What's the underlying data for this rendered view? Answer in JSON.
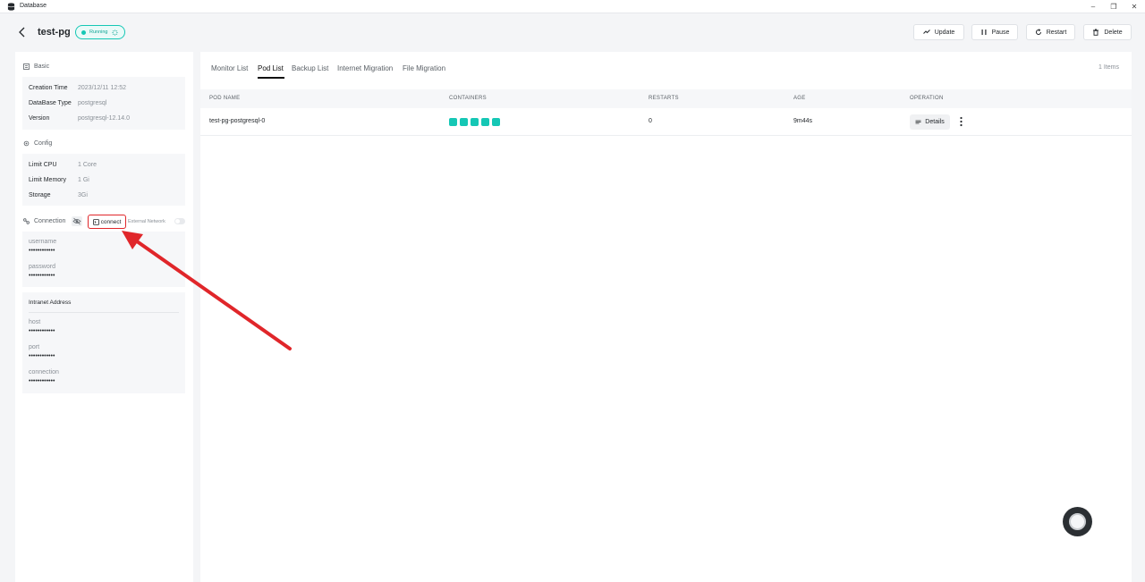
{
  "window": {
    "title": "Database",
    "minimize": "–",
    "restore": "❐",
    "close": "✕"
  },
  "header": {
    "title": "test-pg",
    "status": "Running",
    "buttons": {
      "update": "Update",
      "pause": "Pause",
      "restart": "Restart",
      "delete": "Delete"
    }
  },
  "basic": {
    "title": "Basic",
    "rows": [
      {
        "label": "Creation Time",
        "value": "2023/12/11 12:52"
      },
      {
        "label": "DataBase Type",
        "value": "postgresql"
      },
      {
        "label": "Version",
        "value": "postgresql-12.14.0"
      }
    ]
  },
  "config": {
    "title": "Config",
    "rows": [
      {
        "label": "Limit CPU",
        "value": "1 Core"
      },
      {
        "label": "Limit Memory",
        "value": "1 Gi"
      },
      {
        "label": "Storage",
        "value": "3Gi"
      }
    ]
  },
  "connection": {
    "title": "Connection",
    "connect_label": "connect",
    "external_network": "External Network",
    "username_label": "username",
    "username_value": "••••••••••••",
    "password_label": "password",
    "password_value": "••••••••••••",
    "intranet_title": "Intranet Address",
    "host_label": "host",
    "host_value": "••••••••••••",
    "port_label": "port",
    "port_value": "••••••••••••",
    "connection_label": "connection",
    "connection_value": "••••••••••••"
  },
  "tabs": [
    {
      "label": "Monitor List",
      "active": false
    },
    {
      "label": "Pod List",
      "active": true
    },
    {
      "label": "Backup List",
      "active": false
    },
    {
      "label": "Internet Migration",
      "active": false
    },
    {
      "label": "File Migration",
      "active": false
    }
  ],
  "items_count": "1 Items",
  "table": {
    "headers": {
      "pod_name": "POD NAME",
      "containers": "CONTAINERS",
      "restarts": "RESTARTS",
      "age": "AGE",
      "operation": "OPERATION"
    },
    "rows": [
      {
        "pod_name": "test-pg-postgresql-0",
        "containers": 5,
        "restarts": "0",
        "age": "9m44s",
        "details": "Details"
      }
    ]
  },
  "colors": {
    "accent": "#15c7b5",
    "highlight": "#e0262a"
  }
}
